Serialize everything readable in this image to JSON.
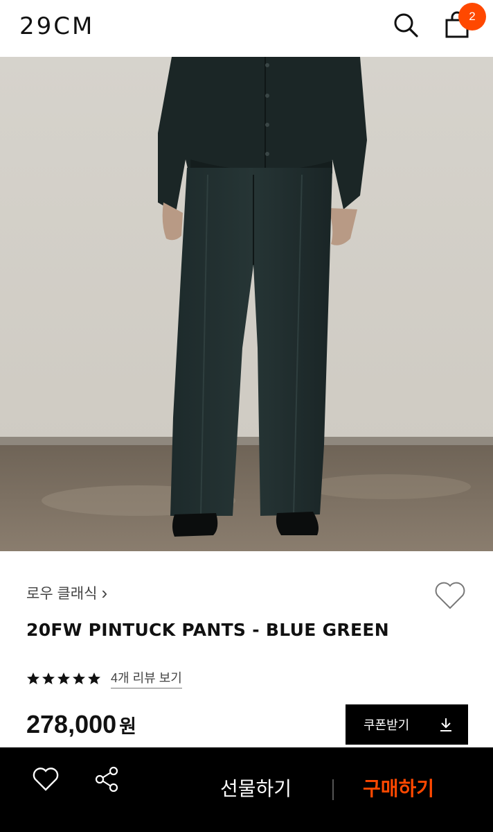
{
  "header": {
    "logo": "29CM",
    "cart_count": "2"
  },
  "product": {
    "brand": "로우 클래식",
    "brand_chevron": "›",
    "title": "20FW PINTUCK PANTS - BLUE GREEN",
    "rating": 5,
    "rating_max": 5,
    "review_link": "4개 리뷰 보기",
    "price": "278,000",
    "price_unit": "원"
  },
  "coupon": {
    "label": "쿠폰받기",
    "icon": "download-icon"
  },
  "bottom_bar": {
    "wish_icon": "heart-icon",
    "share_icon": "share-icon",
    "gift_label": "선물하기",
    "buy_label": "구매하기"
  },
  "colors": {
    "accent": "#ff4800",
    "bottom_bar_bg": "#000000",
    "coupon_bg": "#000000"
  }
}
